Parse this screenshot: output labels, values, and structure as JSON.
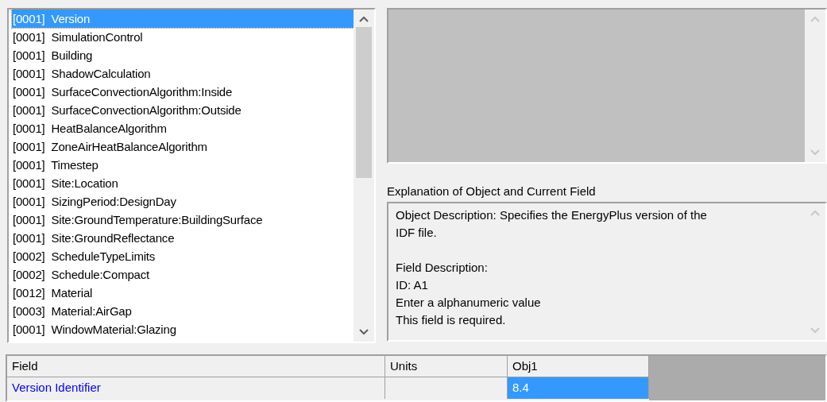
{
  "object_list": {
    "items": [
      {
        "count": "[0001]",
        "name": "Version",
        "selected": true
      },
      {
        "count": "[0001]",
        "name": "SimulationControl",
        "selected": false
      },
      {
        "count": "[0001]",
        "name": "Building",
        "selected": false
      },
      {
        "count": "[0001]",
        "name": "ShadowCalculation",
        "selected": false
      },
      {
        "count": "[0001]",
        "name": "SurfaceConvectionAlgorithm:Inside",
        "selected": false
      },
      {
        "count": "[0001]",
        "name": "SurfaceConvectionAlgorithm:Outside",
        "selected": false
      },
      {
        "count": "[0001]",
        "name": "HeatBalanceAlgorithm",
        "selected": false
      },
      {
        "count": "[0001]",
        "name": "ZoneAirHeatBalanceAlgorithm",
        "selected": false
      },
      {
        "count": "[0001]",
        "name": "Timestep",
        "selected": false
      },
      {
        "count": "[0001]",
        "name": "Site:Location",
        "selected": false
      },
      {
        "count": "[0001]",
        "name": "SizingPeriod:DesignDay",
        "selected": false
      },
      {
        "count": "[0001]",
        "name": "Site:GroundTemperature:BuildingSurface",
        "selected": false
      },
      {
        "count": "[0001]",
        "name": "Site:GroundReflectance",
        "selected": false
      },
      {
        "count": "[0002]",
        "name": "ScheduleTypeLimits",
        "selected": false
      },
      {
        "count": "[0002]",
        "name": "Schedule:Compact",
        "selected": false
      },
      {
        "count": "[0012]",
        "name": "Material",
        "selected": false
      },
      {
        "count": "[0003]",
        "name": "Material:AirGap",
        "selected": false
      },
      {
        "count": "[0001]",
        "name": "WindowMaterial:Glazing",
        "selected": false
      }
    ]
  },
  "explanation": {
    "label": "Explanation of Object and Current Field",
    "paragraphs": [
      [
        "Object Description: Specifies the EnergyPlus version of the IDF file."
      ],
      [
        "Field Description:",
        "ID: A1",
        "Enter a alphanumeric value",
        "This field is required."
      ]
    ]
  },
  "grid": {
    "columns": [
      "Field",
      "Units",
      "Obj1"
    ],
    "rows": [
      {
        "field": "Version Identifier",
        "values": [
          {
            "text": "8.4",
            "selected": true
          }
        ]
      }
    ]
  }
}
